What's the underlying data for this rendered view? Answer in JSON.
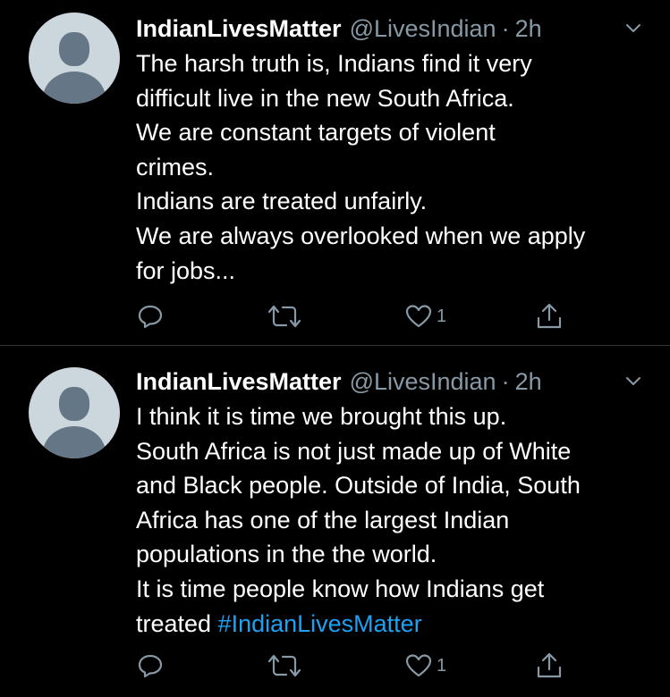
{
  "tweets": [
    {
      "display_name": "IndianLivesMatter",
      "handle": "@LivesIndian",
      "separator": "·",
      "time": "2h",
      "lines": [
        "The harsh truth is, Indians find it very",
        "difficult live in the new South Africa.",
        "We are constant targets of violent",
        "crimes.",
        "Indians are treated unfairly.",
        "We are always overlooked when we apply",
        "for jobs..."
      ],
      "like_count": "1",
      "icons": [
        "reply-icon",
        "retweet-icon",
        "like-icon",
        "share-icon",
        "chevron-down-icon"
      ]
    },
    {
      "display_name": "IndianLivesMatter",
      "handle": "@LivesIndian",
      "separator": "·",
      "time": "2h",
      "lines": [
        "I think it is time we brought this up.",
        "South Africa is not just made up of White",
        "and Black people. Outside of India, South",
        "Africa has one of the largest Indian",
        "populations in the the world.",
        "It is time people know how Indians get"
      ],
      "last_line_prefix": "treated ",
      "hashtag": "#IndianLivesMatter",
      "like_count": "1",
      "icons": [
        "reply-icon",
        "retweet-icon",
        "like-icon",
        "share-icon",
        "chevron-down-icon"
      ]
    }
  ],
  "colors": {
    "background": "#000000",
    "text": "#ffffff",
    "secondary": "#8899a6",
    "link": "#1da1f2",
    "divider": "#2f3336"
  }
}
